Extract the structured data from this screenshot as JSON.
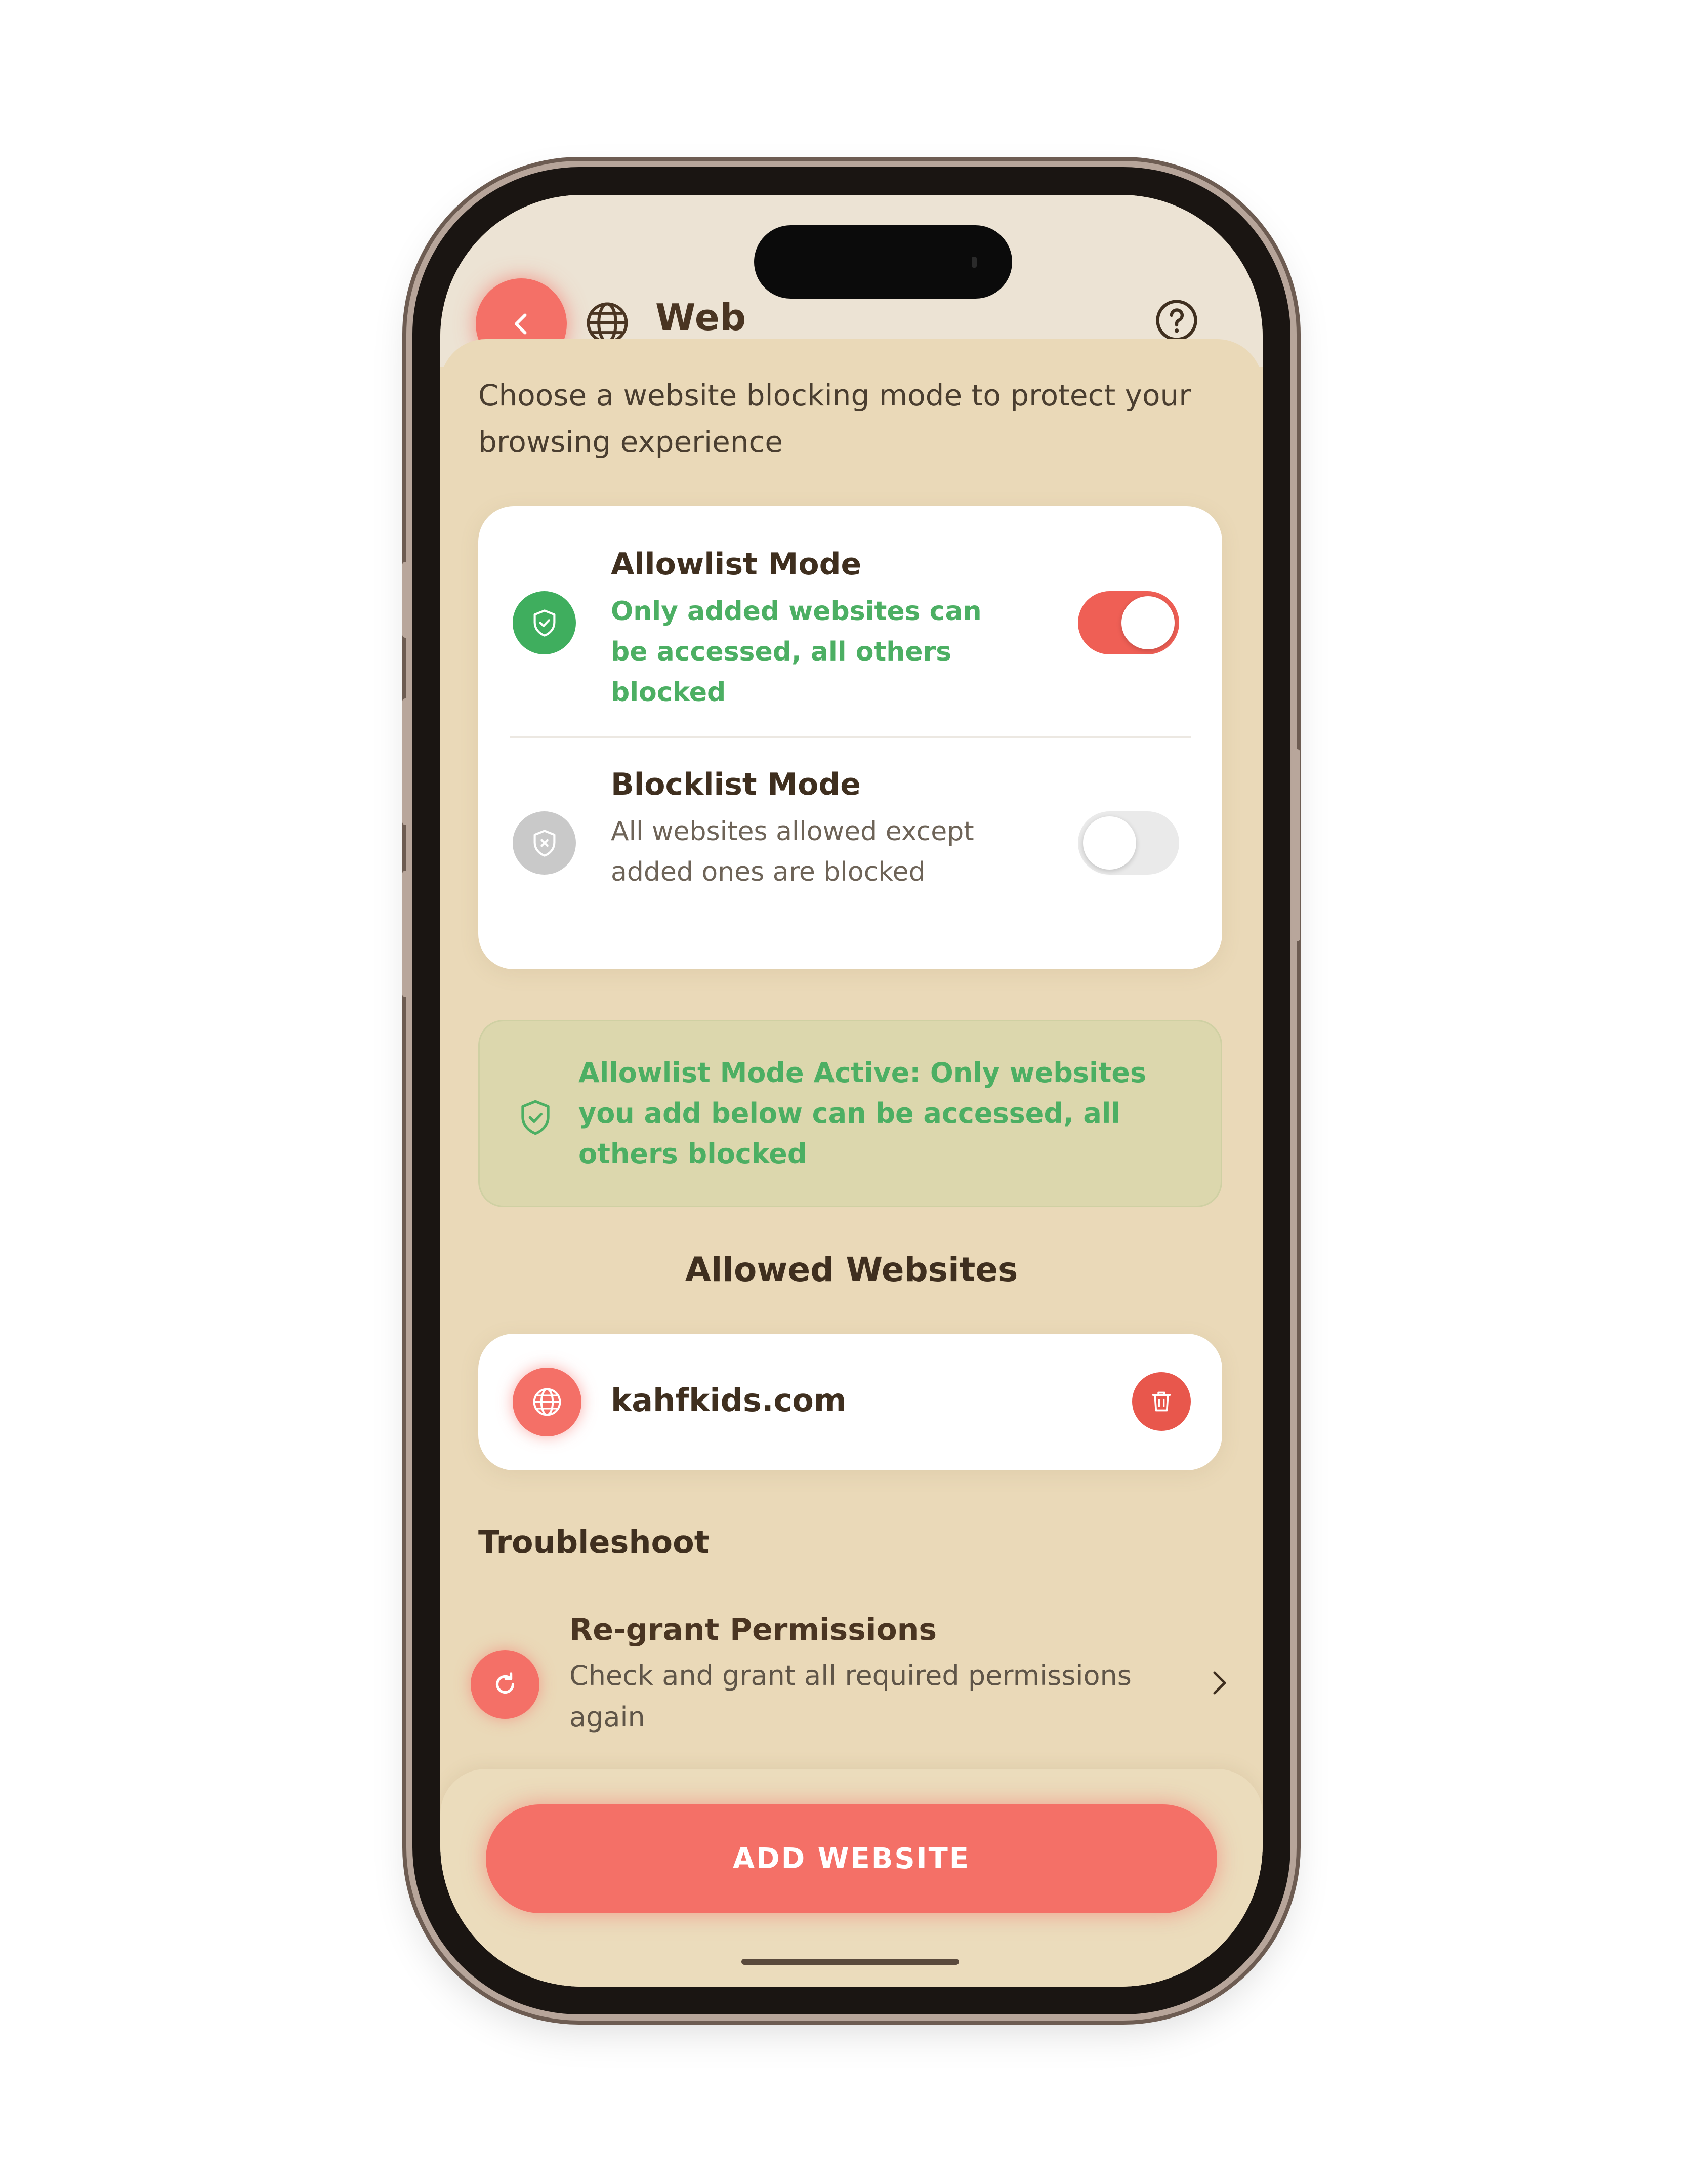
{
  "header": {
    "title": "Web",
    "back_icon": "chevron-left-icon",
    "globe_icon": "globe-icon",
    "help_icon": "help-circle-icon"
  },
  "intro_text": "Choose a website blocking mode to protect your browsing experience",
  "modes": [
    {
      "title": "Allowlist Mode",
      "description": "Only added websites can be accessed, all others blocked",
      "icon": "shield-check-icon",
      "enabled": true
    },
    {
      "title": "Blocklist Mode",
      "description": "All websites allowed except added ones are blocked",
      "icon": "shield-x-icon",
      "enabled": false
    }
  ],
  "status_banner": {
    "icon": "shield-check-icon",
    "text": "Allowlist Mode Active: Only websites you add below can be accessed, all others blocked"
  },
  "allowed_section": {
    "heading": "Allowed Websites",
    "websites": [
      {
        "name": "kahfkids.com",
        "icon": "globe-icon",
        "delete_icon": "trash-icon"
      }
    ]
  },
  "troubleshoot": {
    "heading": "Troubleshoot",
    "items": [
      {
        "title": "Re-grant Permissions",
        "description": "Check and grant all required permissions again",
        "icon": "refresh-icon",
        "chevron_icon": "chevron-right-icon"
      }
    ]
  },
  "footer": {
    "add_button_label": "ADD WEBSITE"
  },
  "colors": {
    "accent": "#f47067",
    "success": "#4caf63",
    "background": "#ead9b8",
    "card": "#ffffff",
    "text_dark": "#3f2f1f"
  }
}
